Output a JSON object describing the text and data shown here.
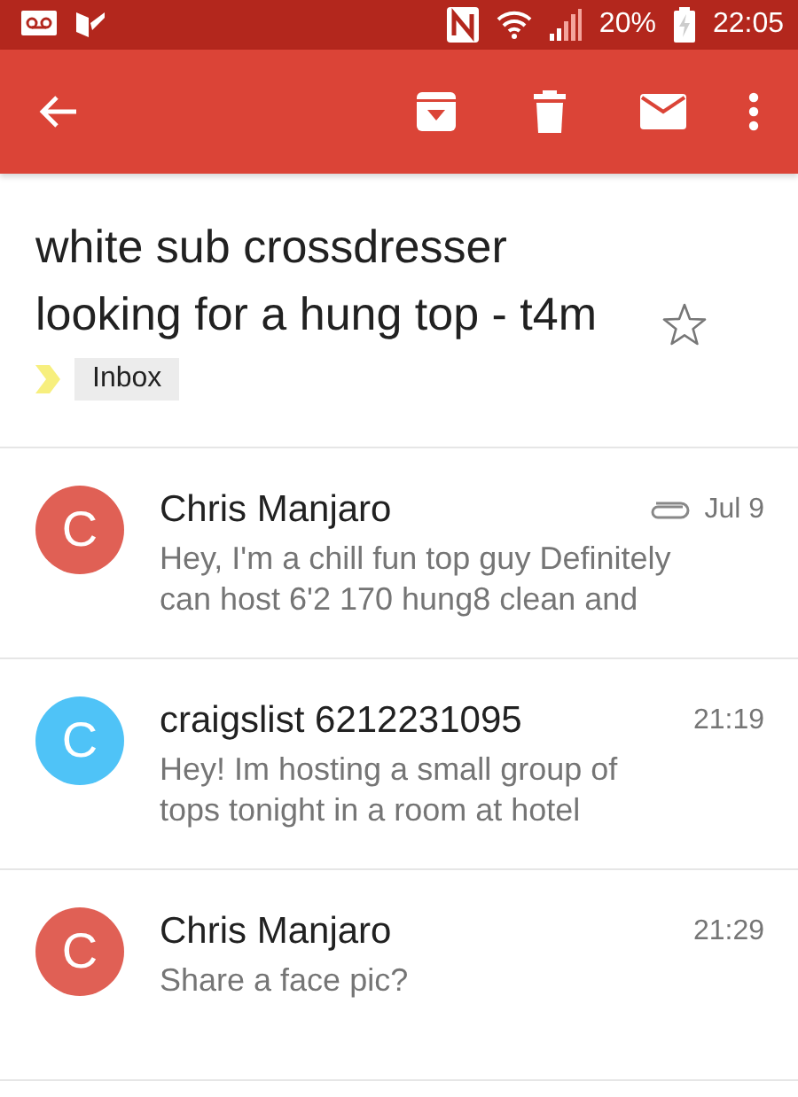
{
  "status_bar": {
    "battery": "20%",
    "time": "22:05",
    "charging": true
  },
  "app_bar": {
    "actions": [
      {
        "kind": "archive"
      },
      {
        "kind": "delete"
      },
      {
        "kind": "mark-unread"
      },
      {
        "kind": "more"
      }
    ]
  },
  "subject": {
    "text": "white sub crossdresser looking for a hung top - t4m",
    "starred": false,
    "important": true,
    "label": "Inbox"
  },
  "messages": [
    {
      "initial": "C",
      "color": "#e06055",
      "sender": "Chris Manjaro",
      "attachment": true,
      "date": "Jul 9",
      "snippet": "Hey, I'm a chill fun top guy Definitely can host 6'2 170 hung8 clean and"
    },
    {
      "initial": "C",
      "color": "#4fc3f7",
      "sender": "craigslist 6212231095",
      "attachment": false,
      "date": "21:19",
      "snippet": "Hey! Im hosting a small group of tops tonight in a room at hotel"
    },
    {
      "initial": "C",
      "color": "#e06055",
      "sender": "Chris Manjaro",
      "attachment": false,
      "date": "21:29",
      "snippet": "Share a face pic?"
    }
  ]
}
